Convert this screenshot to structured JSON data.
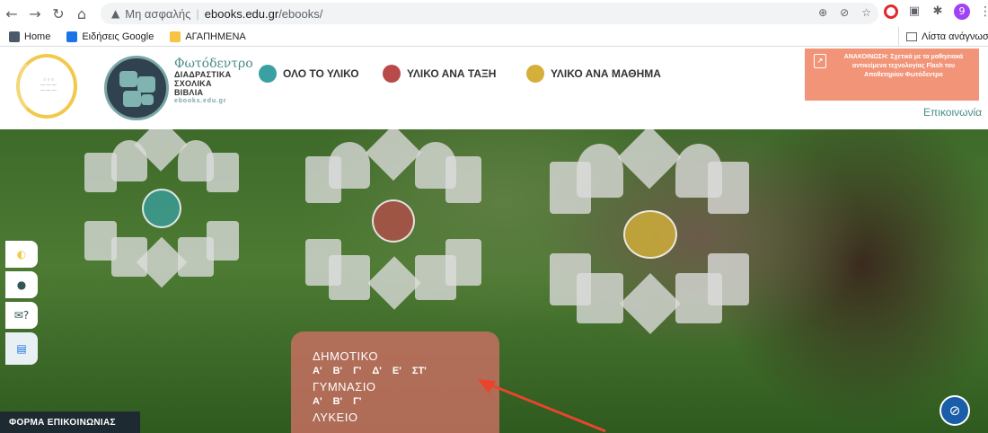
{
  "browser": {
    "security_text": "Μη ασφαλής",
    "url_host": "ebooks.edu.gr",
    "url_path": "/ebooks/",
    "avatar_letter": "9"
  },
  "bookmarks": {
    "items": [
      {
        "label": "Home"
      },
      {
        "label": "Ειδήσεις Google"
      },
      {
        "label": "ΑΓΑΠΗΜΕΝΑ"
      }
    ],
    "reading_list": "Λίστα ανάγνωσης"
  },
  "site": {
    "brand_name": "Φωτόδεντρο",
    "brand_line1": "ΔΙΑΔΡΑΣΤΙΚΑ",
    "brand_line2": "ΣΧΟΛΙΚΑ",
    "brand_line3": "ΒΙΒΛΙΑ",
    "brand_url": "ebooks.edu.gr",
    "menu": [
      {
        "label": "ΟΛΟ ΤΟ ΥΛΙΚΟ",
        "color": "#3aa0a2"
      },
      {
        "label": "ΥΛΙΚΟ ΑΝΑ ΤΑΞΗ",
        "color": "#b84a4a"
      },
      {
        "label": "ΥΛΙΚΟ ΑΝΑ ΜΑΘΗΜΑ",
        "color": "#d4b03a"
      }
    ],
    "notice": "ΑΝΑΚΟΙΝΩΣΗ: Σχετικά με τα μαθησιακά αντικείμενα τεχνολογίας Flash του Αποθετηρίου Φωτόδεντρο",
    "contact_link": "Επικοινωνία"
  },
  "grades": {
    "primary_title": "ΔΗΜΟΤΙΚΟ",
    "primary_classes": [
      "Α'",
      "Β'",
      "Γ'",
      "Δ'",
      "Ε'",
      "ΣΤ'"
    ],
    "gymnasium_title": "ΓΥΜΝΑΣΙΟ",
    "gymnasium_classes": [
      "Α'",
      "Β'",
      "Γ'"
    ],
    "lyceum_title": "ΛΥΚΕΙΟ"
  },
  "footer": {
    "contact_form": "ΦΟΡΜΑ ΕΠΙΚΟΙΝΩΝΙΑΣ"
  },
  "icons": {
    "back": "arrow-left-icon",
    "forward": "arrow-right-icon",
    "reload": "reload-icon",
    "home": "home-icon",
    "warning": "warning-icon",
    "accessibility": "eye-slash-icon"
  },
  "colors": {
    "accent": "#4a8c88",
    "notice_bg": "#f29478",
    "grades_bg": "#c66e60",
    "footer_bg": "#1e2a32"
  }
}
